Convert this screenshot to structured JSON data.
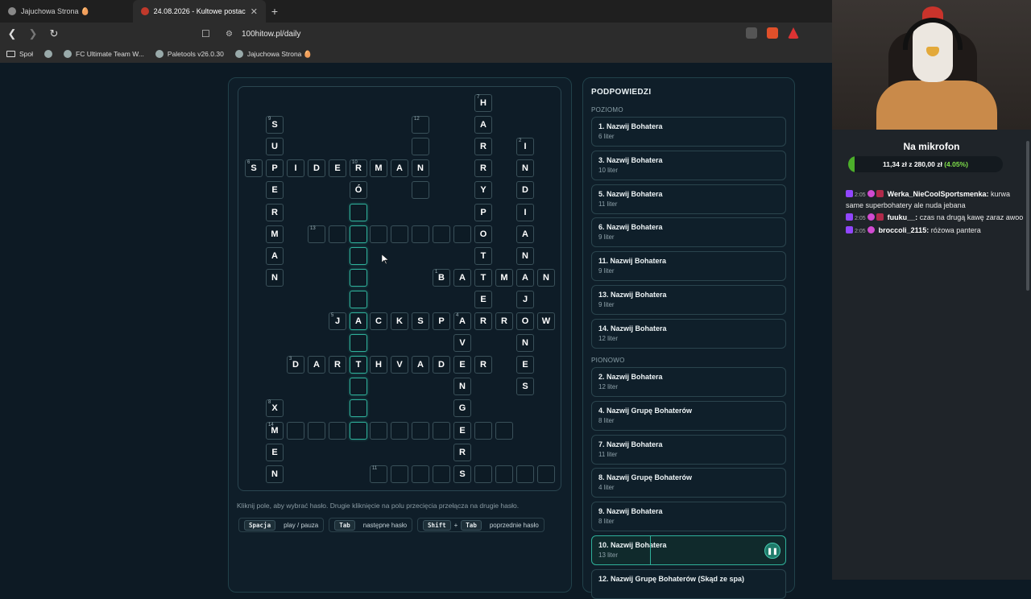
{
  "browser": {
    "tabs": [
      {
        "title": "Jajuchowa Strona 🥚",
        "active": false
      },
      {
        "title": "24.08.2026 - Kultowe postaci",
        "active": true
      }
    ],
    "url": "100hitow.pl/daily",
    "bookmarks": [
      "Społ",
      "",
      "FC Ultimate Team W...",
      "Paletools v26.0.30",
      "Jajuchowa Strona 🥚"
    ]
  },
  "crossword": {
    "cells": [
      {
        "r": 0,
        "c": 11,
        "ch": "H",
        "n": "7"
      },
      {
        "r": 1,
        "c": 1,
        "ch": "S",
        "n": "9"
      },
      {
        "r": 1,
        "c": 8,
        "ch": "",
        "n": "12"
      },
      {
        "r": 1,
        "c": 11,
        "ch": "A"
      },
      {
        "r": 2,
        "c": 1,
        "ch": "U"
      },
      {
        "r": 2,
        "c": 8,
        "ch": ""
      },
      {
        "r": 2,
        "c": 11,
        "ch": "R"
      },
      {
        "r": 2,
        "c": 13,
        "ch": "I",
        "n": "2"
      },
      {
        "r": 3,
        "c": 0,
        "ch": "S",
        "n": "6"
      },
      {
        "r": 3,
        "c": 1,
        "ch": "P"
      },
      {
        "r": 3,
        "c": 2,
        "ch": "I"
      },
      {
        "r": 3,
        "c": 3,
        "ch": "D"
      },
      {
        "r": 3,
        "c": 4,
        "ch": "E"
      },
      {
        "r": 3,
        "c": 5,
        "ch": "R",
        "n": "10"
      },
      {
        "r": 3,
        "c": 6,
        "ch": "M"
      },
      {
        "r": 3,
        "c": 7,
        "ch": "A"
      },
      {
        "r": 3,
        "c": 8,
        "ch": "N"
      },
      {
        "r": 3,
        "c": 11,
        "ch": "R"
      },
      {
        "r": 3,
        "c": 13,
        "ch": "N"
      },
      {
        "r": 4,
        "c": 1,
        "ch": "E"
      },
      {
        "r": 4,
        "c": 5,
        "ch": "Ó"
      },
      {
        "r": 4,
        "c": 8,
        "ch": ""
      },
      {
        "r": 4,
        "c": 11,
        "ch": "Y"
      },
      {
        "r": 4,
        "c": 13,
        "ch": "D"
      },
      {
        "r": 5,
        "c": 1,
        "ch": "R"
      },
      {
        "r": 5,
        "c": 5,
        "ch": "",
        "on": true
      },
      {
        "r": 5,
        "c": 11,
        "ch": "P"
      },
      {
        "r": 5,
        "c": 13,
        "ch": "I"
      },
      {
        "r": 6,
        "c": 1,
        "ch": "M"
      },
      {
        "r": 6,
        "c": 3,
        "ch": "",
        "n": "13"
      },
      {
        "r": 6,
        "c": 4,
        "ch": ""
      },
      {
        "r": 6,
        "c": 5,
        "ch": "",
        "on": true
      },
      {
        "r": 6,
        "c": 6,
        "ch": ""
      },
      {
        "r": 6,
        "c": 7,
        "ch": ""
      },
      {
        "r": 6,
        "c": 8,
        "ch": ""
      },
      {
        "r": 6,
        "c": 9,
        "ch": ""
      },
      {
        "r": 6,
        "c": 10,
        "ch": ""
      },
      {
        "r": 6,
        "c": 11,
        "ch": "O"
      },
      {
        "r": 6,
        "c": 13,
        "ch": "A"
      },
      {
        "r": 7,
        "c": 1,
        "ch": "A"
      },
      {
        "r": 7,
        "c": 5,
        "ch": "",
        "on": true
      },
      {
        "r": 7,
        "c": 11,
        "ch": "T"
      },
      {
        "r": 7,
        "c": 13,
        "ch": "N"
      },
      {
        "r": 8,
        "c": 1,
        "ch": "N"
      },
      {
        "r": 8,
        "c": 5,
        "ch": "",
        "on": true
      },
      {
        "r": 8,
        "c": 9,
        "ch": "B",
        "n": "1"
      },
      {
        "r": 8,
        "c": 10,
        "ch": "A"
      },
      {
        "r": 8,
        "c": 11,
        "ch": "T"
      },
      {
        "r": 8,
        "c": 12,
        "ch": "M"
      },
      {
        "r": 8,
        "c": 13,
        "ch": "A"
      },
      {
        "r": 8,
        "c": 14,
        "ch": "N"
      },
      {
        "r": 9,
        "c": 5,
        "ch": "",
        "on": true
      },
      {
        "r": 9,
        "c": 11,
        "ch": "E"
      },
      {
        "r": 9,
        "c": 13,
        "ch": "J"
      },
      {
        "r": 10,
        "c": 4,
        "ch": "J",
        "n": "5"
      },
      {
        "r": 10,
        "c": 5,
        "ch": "A",
        "on": true
      },
      {
        "r": 10,
        "c": 6,
        "ch": "C"
      },
      {
        "r": 10,
        "c": 7,
        "ch": "K"
      },
      {
        "r": 10,
        "c": 8,
        "ch": "S"
      },
      {
        "r": 10,
        "c": 9,
        "ch": "P"
      },
      {
        "r": 10,
        "c": 10,
        "ch": "A",
        "n": "4"
      },
      {
        "r": 10,
        "c": 11,
        "ch": "R"
      },
      {
        "r": 10,
        "c": 12,
        "ch": "R"
      },
      {
        "r": 10,
        "c": 13,
        "ch": "O"
      },
      {
        "r": 10,
        "c": 14,
        "ch": "W"
      },
      {
        "r": 11,
        "c": 5,
        "ch": "",
        "on": true
      },
      {
        "r": 11,
        "c": 10,
        "ch": "V"
      },
      {
        "r": 11,
        "c": 13,
        "ch": "N"
      },
      {
        "r": 12,
        "c": 2,
        "ch": "D",
        "n": "3"
      },
      {
        "r": 12,
        "c": 3,
        "ch": "A"
      },
      {
        "r": 12,
        "c": 4,
        "ch": "R"
      },
      {
        "r": 12,
        "c": 5,
        "ch": "T",
        "on": true
      },
      {
        "r": 12,
        "c": 6,
        "ch": "H"
      },
      {
        "r": 12,
        "c": 7,
        "ch": "V"
      },
      {
        "r": 12,
        "c": 8,
        "ch": "A"
      },
      {
        "r": 12,
        "c": 9,
        "ch": "D"
      },
      {
        "r": 12,
        "c": 10,
        "ch": "E"
      },
      {
        "r": 12,
        "c": 11,
        "ch": "R"
      },
      {
        "r": 12,
        "c": 13,
        "ch": "E"
      },
      {
        "r": 13,
        "c": 5,
        "ch": "",
        "on": true
      },
      {
        "r": 13,
        "c": 10,
        "ch": "N"
      },
      {
        "r": 13,
        "c": 13,
        "ch": "S"
      },
      {
        "r": 14,
        "c": 1,
        "ch": "X",
        "n": "8"
      },
      {
        "r": 14,
        "c": 5,
        "ch": "",
        "on": true
      },
      {
        "r": 14,
        "c": 10,
        "ch": "G"
      },
      {
        "r": 15,
        "c": 1,
        "ch": "M",
        "n": "14"
      },
      {
        "r": 15,
        "c": 2,
        "ch": ""
      },
      {
        "r": 15,
        "c": 3,
        "ch": ""
      },
      {
        "r": 15,
        "c": 4,
        "ch": ""
      },
      {
        "r": 15,
        "c": 5,
        "ch": "",
        "on": true
      },
      {
        "r": 15,
        "c": 6,
        "ch": ""
      },
      {
        "r": 15,
        "c": 7,
        "ch": ""
      },
      {
        "r": 15,
        "c": 8,
        "ch": ""
      },
      {
        "r": 15,
        "c": 9,
        "ch": ""
      },
      {
        "r": 15,
        "c": 10,
        "ch": "E"
      },
      {
        "r": 15,
        "c": 11,
        "ch": ""
      },
      {
        "r": 15,
        "c": 12,
        "ch": ""
      },
      {
        "r": 16,
        "c": 1,
        "ch": "E"
      },
      {
        "r": 16,
        "c": 10,
        "ch": "R"
      },
      {
        "r": 17,
        "c": 1,
        "ch": "N"
      },
      {
        "r": 17,
        "c": 6,
        "ch": "",
        "n": "11"
      },
      {
        "r": 17,
        "c": 7,
        "ch": ""
      },
      {
        "r": 17,
        "c": 8,
        "ch": ""
      },
      {
        "r": 17,
        "c": 9,
        "ch": ""
      },
      {
        "r": 17,
        "c": 10,
        "ch": "S"
      },
      {
        "r": 17,
        "c": 11,
        "ch": ""
      },
      {
        "r": 17,
        "c": 12,
        "ch": ""
      },
      {
        "r": 17,
        "c": 13,
        "ch": ""
      },
      {
        "r": 17,
        "c": 14,
        "ch": ""
      }
    ],
    "hint": "Kliknij pole, aby wybrać hasło. Drugie kliknięcie na polu przecięcia przełącza na drugie hasło.",
    "keys": [
      {
        "keys": [
          "Spacja"
        ],
        "label": "play / pauza"
      },
      {
        "keys": [
          "Tab"
        ],
        "label": "następne hasło"
      },
      {
        "keys": [
          "Shift",
          "Tab"
        ],
        "label": "poprzednie hasło"
      }
    ]
  },
  "clues": {
    "title": "PODPOWIEDZI",
    "across_label": "POZIOMO",
    "down_label": "PIONOWO",
    "across": [
      {
        "title": "1. Nazwij Bohatera",
        "sub": "6 liter"
      },
      {
        "title": "3. Nazwij Bohatera",
        "sub": "10 liter"
      },
      {
        "title": "5. Nazwij Bohatera",
        "sub": "11 liter"
      },
      {
        "title": "6. Nazwij Bohatera",
        "sub": "9 liter"
      },
      {
        "title": "11. Nazwij Bohatera",
        "sub": "9 liter"
      },
      {
        "title": "13. Nazwij Bohatera",
        "sub": "9 liter"
      },
      {
        "title": "14. Nazwij Bohatera",
        "sub": "12 liter"
      }
    ],
    "down": [
      {
        "title": "2. Nazwij Bohatera",
        "sub": "12 liter"
      },
      {
        "title": "4. Nazwij Grupę Bohaterów",
        "sub": "8 liter"
      },
      {
        "title": "7. Nazwij Bohatera",
        "sub": "11 liter"
      },
      {
        "title": "8. Nazwij Grupę Bohaterów",
        "sub": "4 liter"
      },
      {
        "title": "9. Nazwij Bohatera",
        "sub": "8 liter"
      },
      {
        "title": "10. Nazwij Bohatera",
        "sub": "13 liter",
        "active": true,
        "progress": 0.3
      },
      {
        "title": "12. Nazwij Grupę Bohaterów (Skąd ze spa)",
        "sub": ""
      }
    ],
    "pause_icon": "pause-icon"
  },
  "stream": {
    "mic_title": "Na mikrofon",
    "amount": "11,34 zł",
    "of": "z",
    "goal": "280,00 zł",
    "percent": "(4.05%)",
    "progress": 0.0405,
    "messages": [
      {
        "time": "2:05",
        "user": "Werka_NieCoolSportsmenka:",
        "text": "kurwa same superbohatery ale nuda jebana"
      },
      {
        "time": "2:05",
        "user": "fuuku__:",
        "text": "czas na drugą kawę zaraz awoo"
      },
      {
        "time": "2:05",
        "user": "broccoli_2115:",
        "text": "różowa pantera"
      }
    ]
  },
  "colors": {
    "accent": "#2fb09a",
    "progress": "#4caf2a",
    "background": "#0d1a24"
  }
}
